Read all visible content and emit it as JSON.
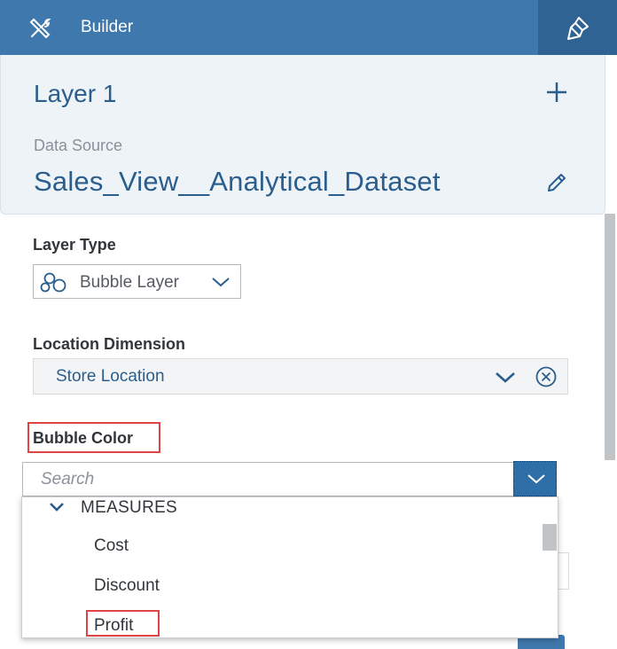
{
  "header": {
    "title": "Builder",
    "tools_icon": "tools-icon",
    "paint_icon": "paint-brush-icon",
    "color": "#3f78ad",
    "active_color": "#2f6393"
  },
  "layer": {
    "name": "Layer 1",
    "add_icon": "plus-icon",
    "data_source_label": "Data Source",
    "data_source_value": "Sales_View__Analytical_Dataset",
    "edit_icon": "pencil-icon"
  },
  "layer_type": {
    "label": "Layer Type",
    "value": "Bubble Layer",
    "icon": "bubble-icon"
  },
  "location_dimension": {
    "label": "Location Dimension",
    "value": "Store Location"
  },
  "bubble_color": {
    "label": "Bubble Color",
    "search_placeholder": "Search",
    "dropdown": {
      "group": "MEASURES",
      "items": [
        "Cost",
        "Discount",
        "Profit"
      ]
    }
  },
  "highlight_color": "#e04343"
}
